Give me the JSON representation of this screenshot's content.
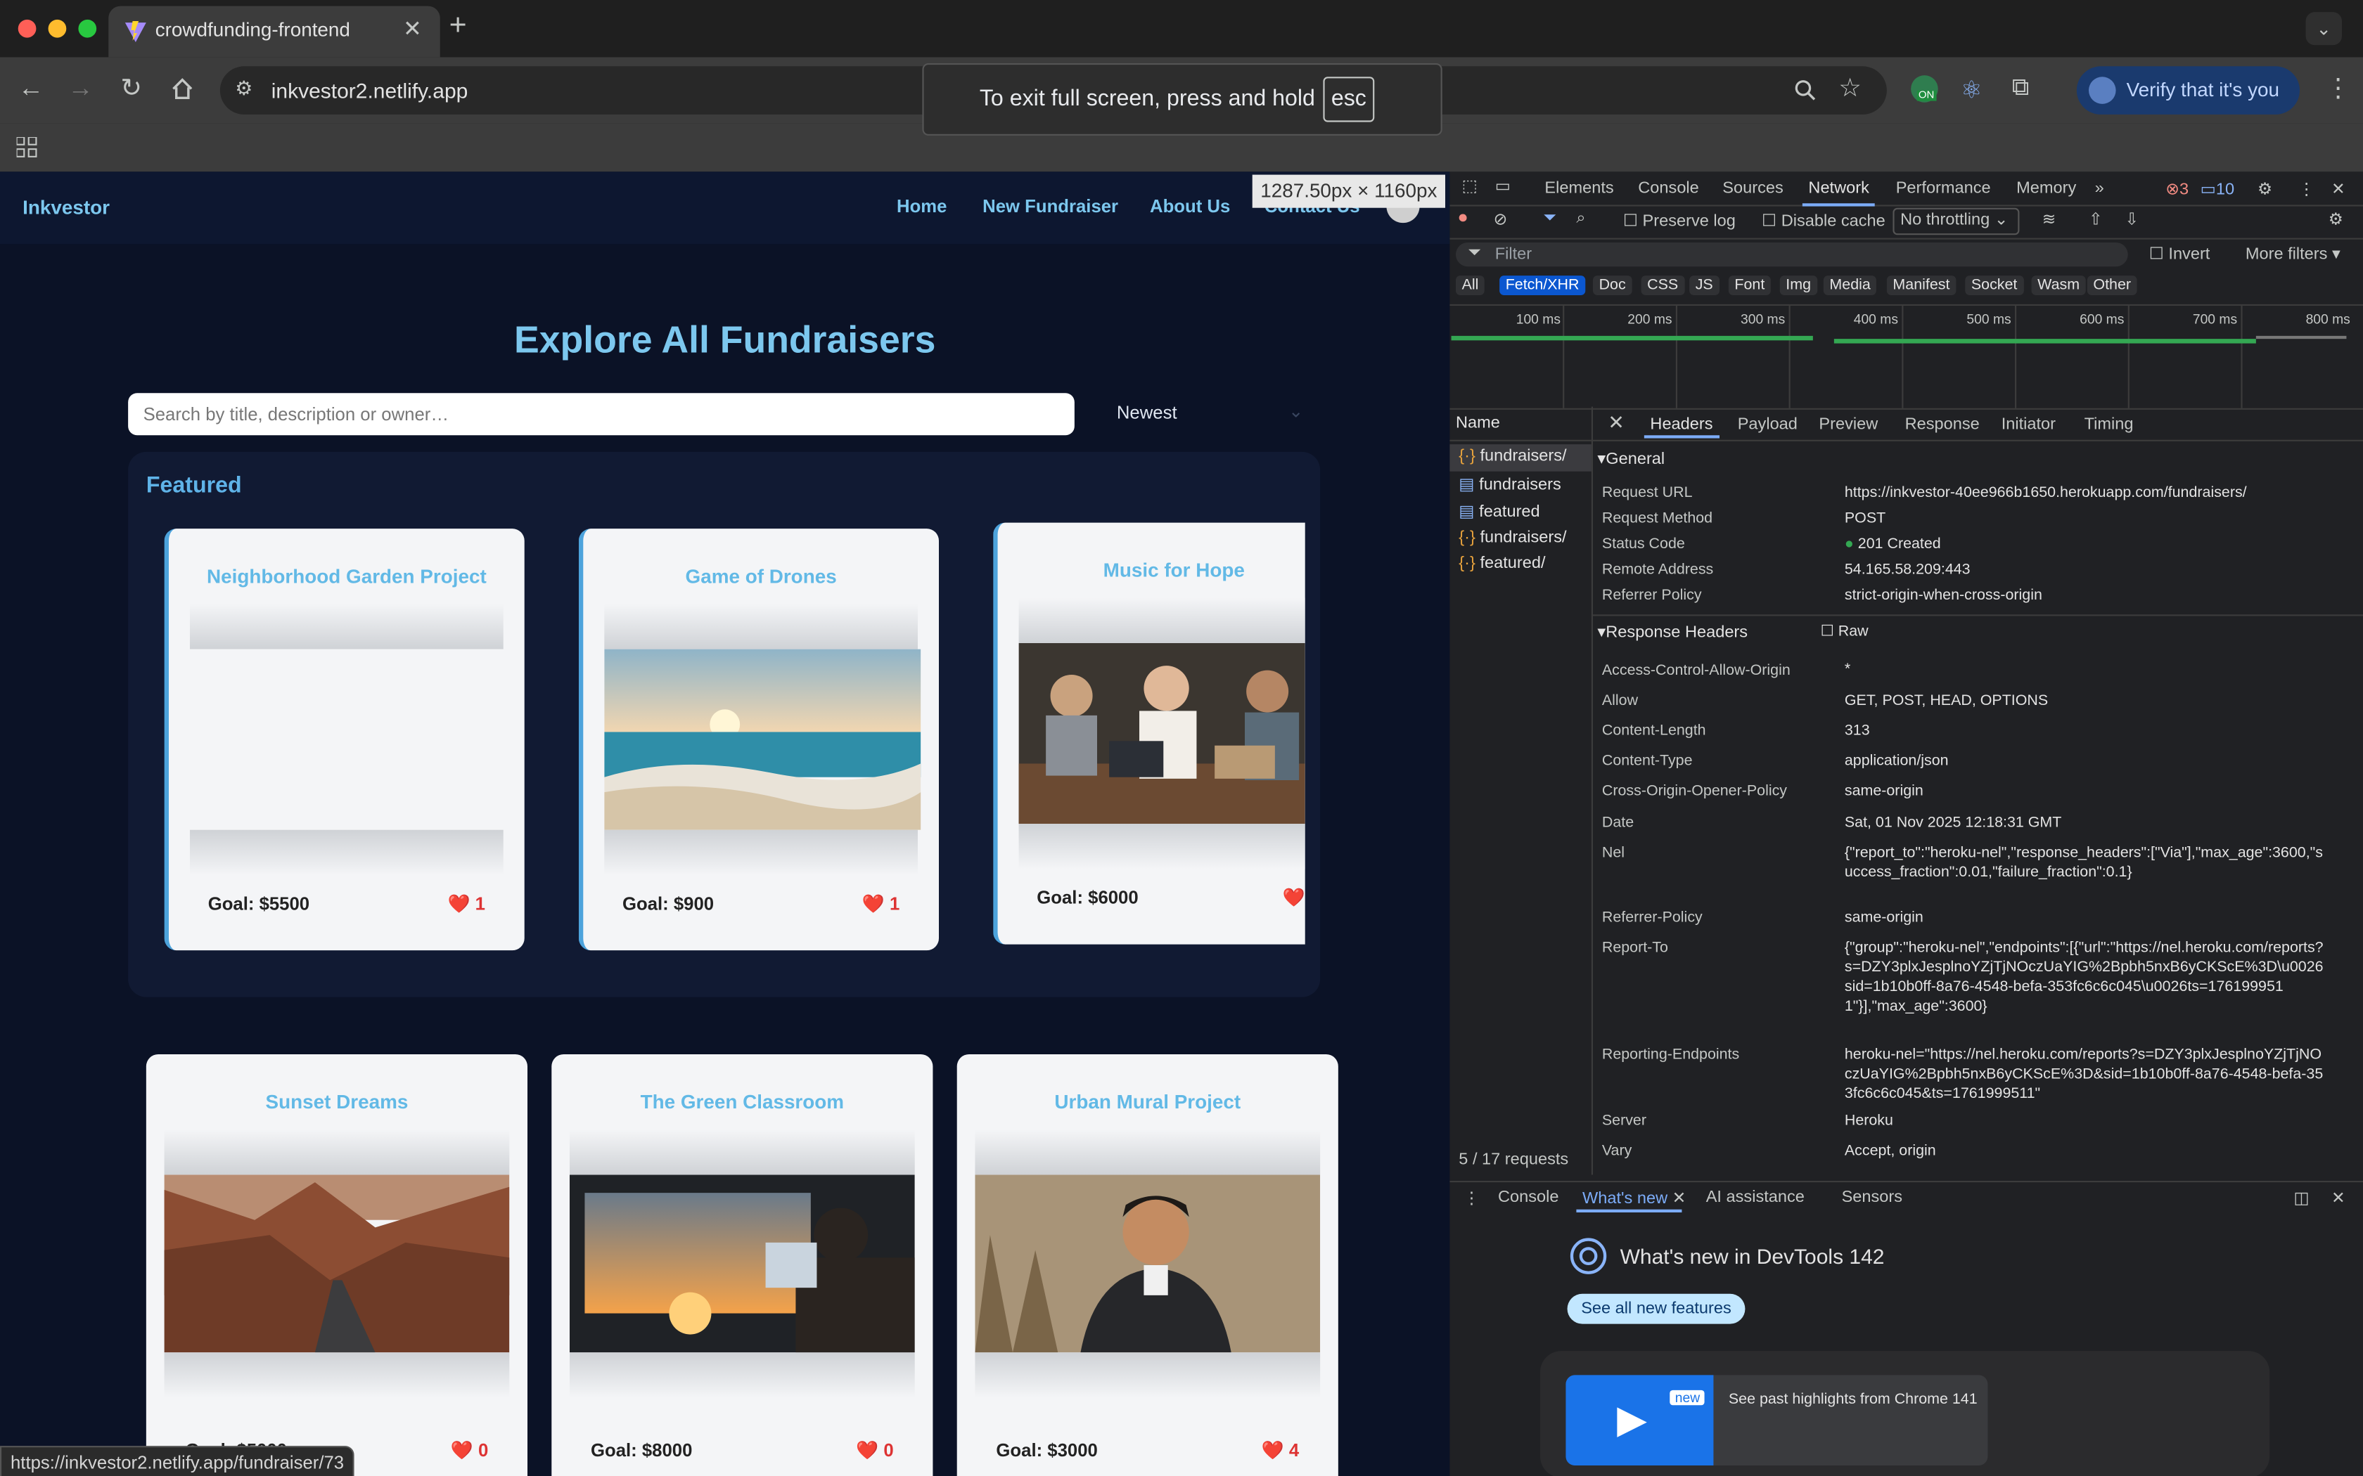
{
  "browser": {
    "tab_title": "crowdfunding-frontend",
    "url": "inkvestor2.netlify.app",
    "verify_label": "Verify that it's you",
    "fullscreen_toast": "To exit full screen, press and hold",
    "fullscreen_key": "esc",
    "extension_badge": "ON",
    "status_url": "https://inkvestor2.netlify.app/fundraiser/73"
  },
  "page": {
    "brand": "Inkvestor",
    "nav": [
      "Home",
      "New Fundraiser",
      "About Us",
      "Contact Us"
    ],
    "dimension_tip": "1287.50px × 1160px",
    "heading": "Explore All Fundraisers",
    "search_placeholder": "Search by title, description or owner…",
    "sort_value": "Newest",
    "featured_label": "Featured",
    "featured_cards": [
      {
        "title": "Neighborhood Garden Project",
        "goal": "Goal: $5500",
        "likes": "1"
      },
      {
        "title": "Game of Drones",
        "goal": "Goal: $900",
        "likes": "1"
      },
      {
        "title": "Music for Hope",
        "goal": "Goal: $6000",
        "likes": ""
      }
    ],
    "cards": [
      {
        "title": "Sunset Dreams",
        "goal": "Goal: $5000",
        "likes": "0"
      },
      {
        "title": "The Green Classroom",
        "goal": "Goal: $8000",
        "likes": "0"
      },
      {
        "title": "Urban Mural Project",
        "goal": "Goal: $3000",
        "likes": "4"
      }
    ]
  },
  "devtools": {
    "tabs": [
      "Elements",
      "Console",
      "Sources",
      "Network",
      "Performance",
      "Memory"
    ],
    "errors": "3",
    "messages": "10",
    "preserve_log": "Preserve log",
    "disable_cache": "Disable cache",
    "throttling": "No throttling",
    "filter_placeholder": "Filter",
    "invert": "Invert",
    "more_filters": "More filters",
    "types": [
      "All",
      "Fetch/XHR",
      "Doc",
      "CSS",
      "JS",
      "Font",
      "Img",
      "Media",
      "Manifest",
      "Socket",
      "Wasm",
      "Other"
    ],
    "ticks": [
      "100 ms",
      "200 ms",
      "300 ms",
      "400 ms",
      "500 ms",
      "600 ms",
      "700 ms",
      "800 ms"
    ],
    "name_header": "Name",
    "requests": [
      "fundraisers/",
      "fundraisers",
      "featured",
      "fundraisers/",
      "featured/"
    ],
    "request_count": "5 / 17 requests",
    "detail_tabs": [
      "Headers",
      "Payload",
      "Preview",
      "Response",
      "Initiator",
      "Timing"
    ],
    "general_label": "General",
    "general": [
      {
        "k": "Request URL",
        "v": "https://inkvestor-40ee966b1650.herokuapp.com/fundraisers/"
      },
      {
        "k": "Request Method",
        "v": "POST"
      },
      {
        "k": "Status Code",
        "v": "201 Created"
      },
      {
        "k": "Remote Address",
        "v": "54.165.58.209:443"
      },
      {
        "k": "Referrer Policy",
        "v": "strict-origin-when-cross-origin"
      }
    ],
    "response_headers_label": "Response Headers",
    "raw_label": "Raw",
    "response_headers": [
      {
        "k": "Access-Control-Allow-Origin",
        "v": "*"
      },
      {
        "k": "Allow",
        "v": "GET, POST, HEAD, OPTIONS"
      },
      {
        "k": "Content-Length",
        "v": "313"
      },
      {
        "k": "Content-Type",
        "v": "application/json"
      },
      {
        "k": "Cross-Origin-Opener-Policy",
        "v": "same-origin"
      },
      {
        "k": "Date",
        "v": "Sat, 01 Nov 2025 12:18:31 GMT"
      },
      {
        "k": "Nel",
        "v": "{\"report_to\":\"heroku-nel\",\"response_headers\":[\"Via\"],\"max_age\":3600,\"success_fraction\":0.01,\"failure_fraction\":0.1}"
      },
      {
        "k": "Referrer-Policy",
        "v": "same-origin"
      },
      {
        "k": "Report-To",
        "v": "{\"group\":\"heroku-nel\",\"endpoints\":[{\"url\":\"https://nel.heroku.com/reports?s=DZY3plxJesplnoYZjTjNOczUaYIG%2Bpbh5nxB6yCKScE%3D\\u0026sid=1b10b0ff-8a76-4548-befa-353fc6c6c045\\u0026ts=1761999511\"}],\"max_age\":3600}"
      },
      {
        "k": "Reporting-Endpoints",
        "v": "heroku-nel=\"https://nel.heroku.com/reports?s=DZY3plxJesplnoYZjTjNOczUaYIG%2Bpbh5nxB6yCKScE%3D&sid=1b10b0ff-8a76-4548-befa-353fc6c6c045&ts=1761999511\""
      },
      {
        "k": "Server",
        "v": "Heroku"
      },
      {
        "k": "Vary",
        "v": "Accept, origin"
      }
    ],
    "drawer_tabs": [
      "Console",
      "What's new",
      "AI assistance",
      "Sensors"
    ],
    "whats_new_title": "What's new in DevTools 142",
    "see_all": "See all new features",
    "new_badge": "new",
    "highlights": "See past highlights from Chrome 141"
  },
  "colors": {
    "page_bg": "#0b1226",
    "accent": "#7cc7ee",
    "devtools_bg": "#202124",
    "active_tab": "#7cacf8"
  }
}
